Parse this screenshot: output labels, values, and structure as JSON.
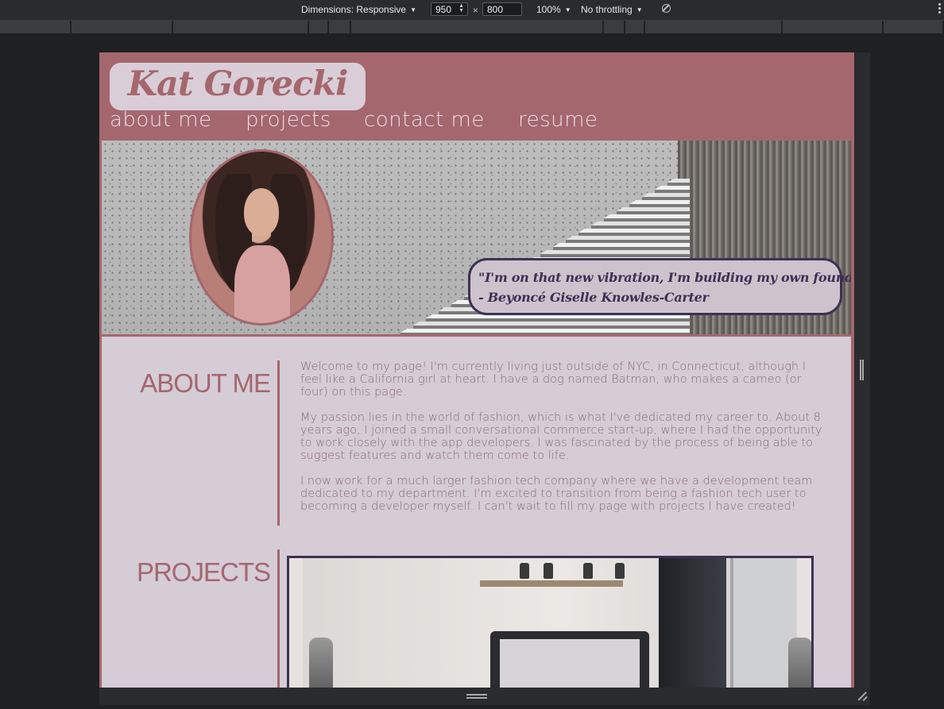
{
  "devtools": {
    "dimensions_label": "Dimensions: Responsive",
    "width_value": "950",
    "height_value": "800",
    "times_symbol": "×",
    "zoom": "100%",
    "throttling": "No throttling",
    "icons": [
      "caret-down-icon",
      "rotate-icon",
      "more-options-icon",
      "resize-grip-icon"
    ]
  },
  "site": {
    "logo": "Kat Gorecki",
    "nav": [
      "about me",
      "projects",
      "contact me",
      "resume"
    ],
    "quote": {
      "line1": "\"I'm on that new vibration, I'm building my own foundation\"",
      "line2": "- Beyoncé Giselle Knowles-Carter"
    },
    "about": {
      "title": "ABOUT ME",
      "paragraphs": [
        "Welcome to my page! I'm currently living just outside of NYC, in Connecticut, although I feel like a California girl at heart. I have a dog named Batman, who makes a cameo (or four) on this page.",
        "My passion lies in the world of fashion, which is what I've dedicated my career to. About 8 years ago, I joined a small conversational commerce start-up, where I had the opportunity to work closely with the app developers. I was fascinated by the process of being able to suggest features and watch them come to life.",
        "I now work for a much larger fashion tech company where we have a development team dedicated to my department. I'm excited to transition from being a fashion tech user to becoming a developer myself. I can't wait to fill my page with projects I have created!"
      ]
    },
    "projects": {
      "title": "PROJECTS"
    },
    "colors": {
      "brand_rose": "#a4676e",
      "page_lilac": "#d5ccd6",
      "accent_navy": "#3c3154"
    }
  }
}
